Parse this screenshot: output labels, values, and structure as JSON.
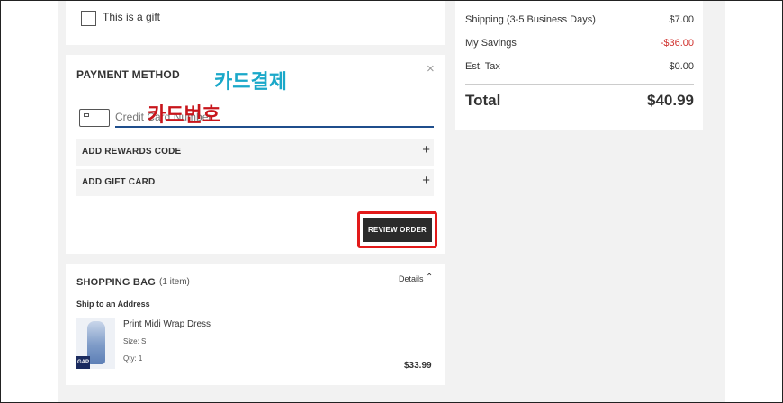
{
  "gift": {
    "label": "This is a gift"
  },
  "payment": {
    "title": "PAYMENT METHOD",
    "close": "×",
    "card_placeholder": "Credit Card Number",
    "rewards_label": "ADD REWARDS CODE",
    "gift_card_label": "ADD GIFT CARD",
    "plus": "+",
    "review_button": "REVIEW ORDER"
  },
  "annotations": {
    "card_payment": "카드결제",
    "card_number": "카드번호"
  },
  "bag": {
    "title": "SHOPPING BAG",
    "count": "(1 item)",
    "details": "Details",
    "chevron": "⌃",
    "ship_label": "Ship to an Address",
    "logo_text": "GAP",
    "item": {
      "name": "Print Midi Wrap Dress",
      "size": "Size: S",
      "qty": "Qty: 1",
      "price": "$33.99"
    }
  },
  "summary": {
    "shipping_label": "Shipping (3-5 Business Days)",
    "shipping_value": "$7.00",
    "savings_label": "My Savings",
    "savings_value": "-$36.00",
    "tax_label": "Est. Tax",
    "tax_value": "$0.00",
    "total_label": "Total",
    "total_value": "$40.99"
  },
  "colors": {
    "accent_blue": "#1f4e8c",
    "highlight_red": "#e21a1a",
    "savings_red": "#d0312d",
    "annotation_cyan": "#1aa8c9",
    "annotation_red": "#c8151b"
  }
}
